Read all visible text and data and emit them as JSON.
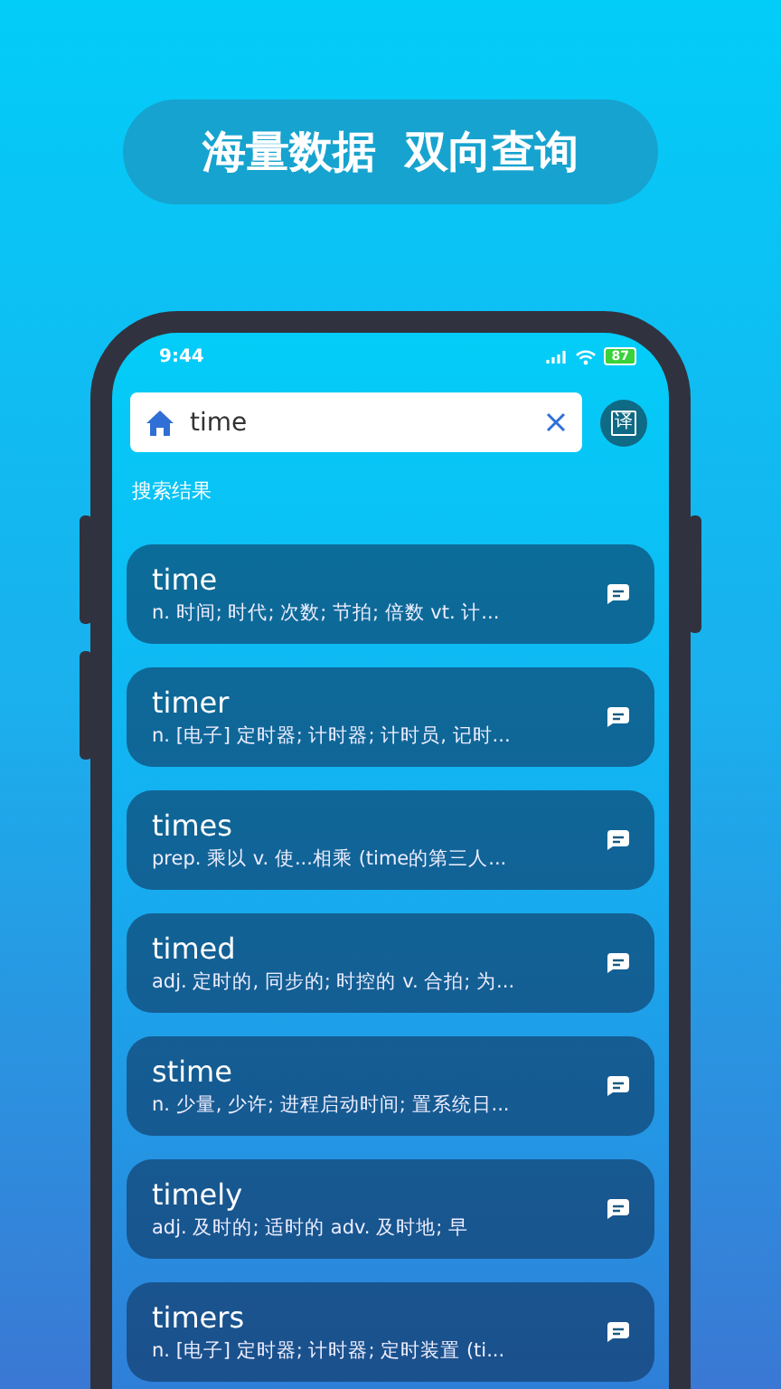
{
  "banner": {
    "title": "海量数据 双向查询"
  },
  "status_bar": {
    "time": "9:44",
    "battery": "87"
  },
  "search": {
    "value": "time"
  },
  "translate_button": {
    "label": "译"
  },
  "section_label": "搜索结果",
  "results": [
    {
      "word": "time",
      "definition": "n. 时间; 时代; 次数; 节拍; 倍数 vt. 计..."
    },
    {
      "word": "timer",
      "definition": "n. [电子] 定时器; 计时器; 计时员, 记时..."
    },
    {
      "word": "times",
      "definition": "prep. 乘以 v. 使...相乘 (time的第三人..."
    },
    {
      "word": "timed",
      "definition": "adj. 定时的, 同步的; 时控的 v. 合拍; 为..."
    },
    {
      "word": "stime",
      "definition": "n. 少量, 少许; 进程启动时间; 置系统日..."
    },
    {
      "word": "timely",
      "definition": "adj. 及时的; 适时的 adv. 及时地; 早"
    },
    {
      "word": "timers",
      "definition": "n. [电子] 定时器; 计时器; 定时装置 (ti..."
    }
  ]
}
